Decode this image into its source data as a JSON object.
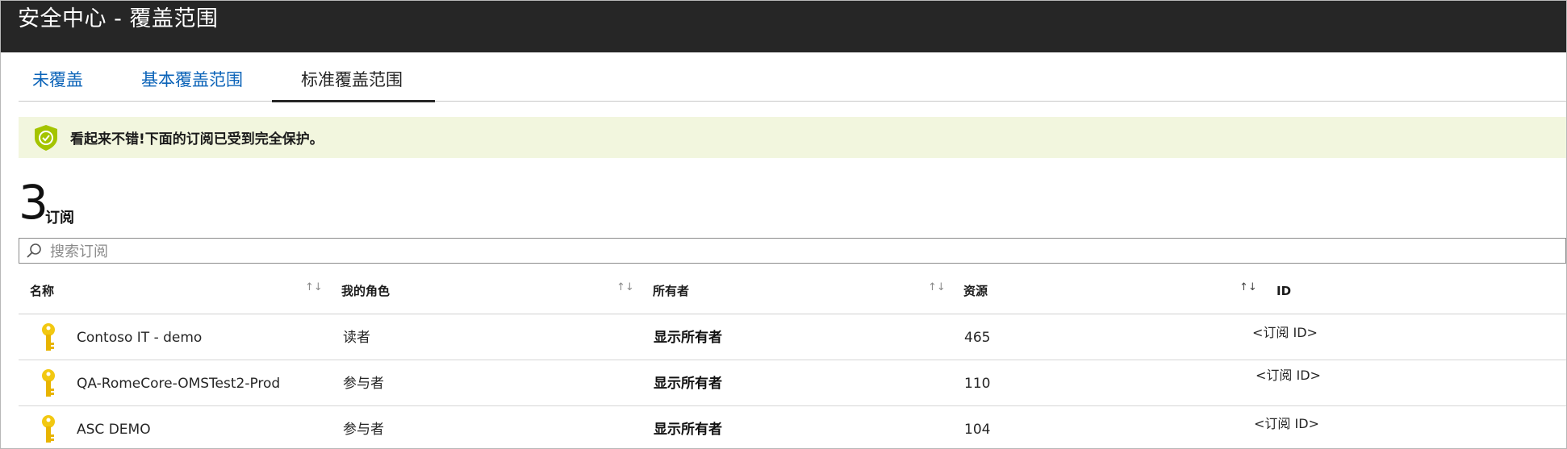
{
  "window": {
    "title": "安全中心 - 覆盖范围"
  },
  "tabs": [
    {
      "label": "未覆盖"
    },
    {
      "label": "基本覆盖范围"
    },
    {
      "label": "标准覆盖范围",
      "selected": true
    }
  ],
  "banner": {
    "message": "看起来不错!下面的订阅已受到完全保护。",
    "icon": "shield-check-icon",
    "color": "#a4c400"
  },
  "summary": {
    "count": "3",
    "label": "订阅"
  },
  "search": {
    "placeholder": "搜索订阅",
    "value": ""
  },
  "table": {
    "columns": [
      "名称",
      "我的角色",
      "所有者",
      "资源",
      "ID"
    ],
    "rows": [
      {
        "name": "Contoso IT - demo",
        "role": "读者",
        "owner": "显示所有者",
        "resources": "465",
        "id": "<订阅 ID>"
      },
      {
        "name": "QA-RomeCore-OMSTest2-Prod",
        "role": "参与者",
        "owner": "显示所有者",
        "resources": "110",
        "id": "<订阅 ID>"
      },
      {
        "name": "ASC DEMO",
        "role": "参与者",
        "owner": "显示所有者",
        "resources": "104",
        "id": "<订阅 ID>"
      }
    ],
    "row_icon": "key-icon",
    "key_color": "#f2c811"
  },
  "colors": {
    "titlebar": "#262626",
    "link": "#0b63b8",
    "banner_bg": "#f2f6de"
  }
}
